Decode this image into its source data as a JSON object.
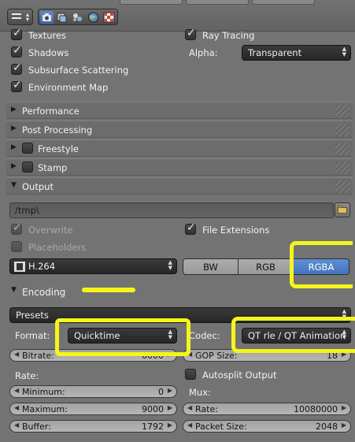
{
  "colors": {
    "accent": "#4a7fcc",
    "highlight": "#f5f51a",
    "panel_bg": "#737373"
  },
  "header": {
    "menu_icon": "editor-type-icon",
    "context_icons": [
      "render-camera-icon",
      "render-layers-icon",
      "scene-icon",
      "world-icon",
      "texture-icon"
    ]
  },
  "shading": {
    "textures": "Textures",
    "ray_tracing": "Ray Tracing",
    "shadows": "Shadows",
    "alpha_label": "Alpha:",
    "alpha_value": "Transparent",
    "subsurface": "Subsurface Scattering",
    "environment_map": "Environment Map"
  },
  "panels": {
    "performance": "Performance",
    "post_processing": "Post Processing",
    "freestyle": "Freestyle",
    "stamp": "Stamp",
    "output": "Output",
    "encoding": "Encoding"
  },
  "output": {
    "path": "/tmp\\",
    "overwrite": "Overwrite",
    "file_extensions": "File Extensions",
    "placeholders": "Placeholders",
    "file_format": "H.264",
    "color_modes": [
      "BW",
      "RGB",
      "RGBA"
    ],
    "active_color_mode": "RGBA"
  },
  "encoding": {
    "presets": "Presets",
    "format_label": "Format:",
    "format_value": "Quicktime",
    "codec_label": "Codec:",
    "codec_value": "QT rle / QT Animation",
    "bitrate_label": "Bitrate:",
    "bitrate_value": "6000",
    "gop_label": "GOP Size:",
    "gop_value": "18",
    "rate_label": "Rate:",
    "autosplit": "Autosplit Output",
    "minimum_label": "Minimum:",
    "minimum_value": "0",
    "mux_label": "Mux:",
    "maximum_label": "Maximum:",
    "maximum_value": "9000",
    "mux_rate_label": "Rate:",
    "mux_rate_value": "10080000",
    "buffer_label": "Buffer:",
    "buffer_value": "1792",
    "packet_label": "Packet Size:",
    "packet_value": "2048"
  }
}
